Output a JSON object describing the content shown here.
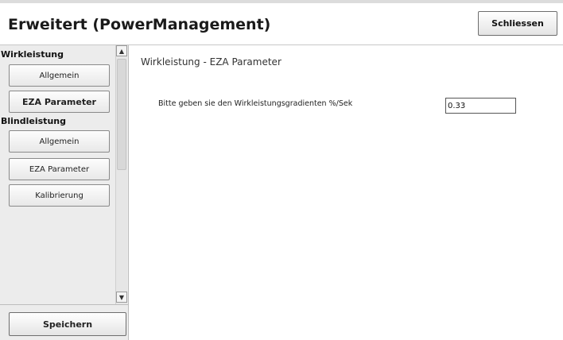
{
  "header": {
    "title": "Erweitert (PowerManagement)",
    "close_label": "Schliessen"
  },
  "sidebar": {
    "sections": [
      {
        "label": "Wirkleistung",
        "items": [
          {
            "label": "Allgemein"
          },
          {
            "label": "EZA Parameter",
            "active": true
          }
        ]
      },
      {
        "label": "Blindleistung",
        "items": [
          {
            "label": "Allgemein"
          },
          {
            "label": "EZA Parameter"
          },
          {
            "label": "Kalibrierung"
          }
        ]
      }
    ],
    "save_label": "Speichern",
    "scroll_up_icon": "chevron-up-icon",
    "scroll_down_icon": "chevron-down-icon"
  },
  "main": {
    "title": "Wirkleistung - EZA Parameter",
    "field": {
      "label": "Bitte geben sie den Wirkleistungsgradienten %/Sek",
      "value": "0.33"
    }
  }
}
